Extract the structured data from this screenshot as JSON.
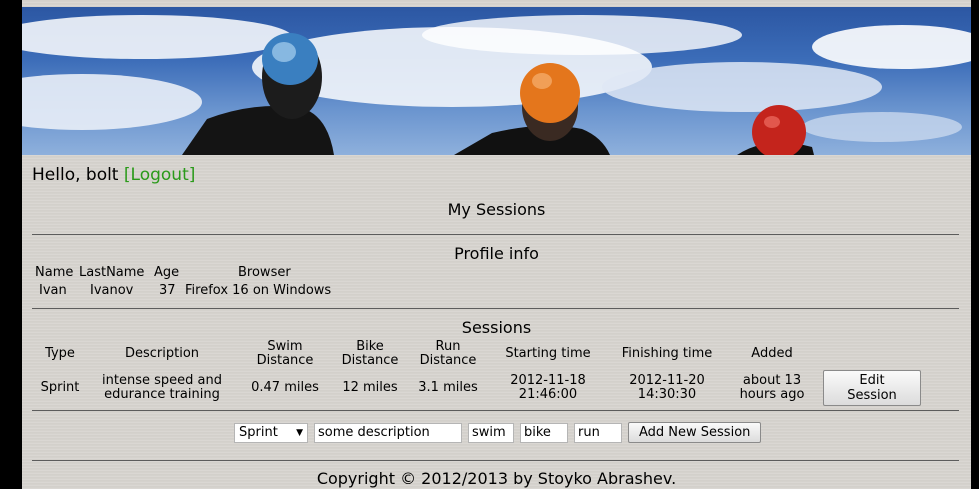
{
  "greeting": {
    "text": "Hello, bolt",
    "logout_label": "[Logout]"
  },
  "page_title": "My Sessions",
  "profile": {
    "title": "Profile info",
    "headers": [
      "Name",
      "LastName",
      "Age",
      "Browser"
    ],
    "values": [
      "Ivan",
      "Ivanov",
      "37",
      "Firefox 16 on Windows"
    ]
  },
  "sessions": {
    "title": "Sessions",
    "headers": {
      "type": "Type",
      "description": "Description",
      "swim_1": "Swim",
      "swim_2": "Distance",
      "bike_1": "Bike",
      "bike_2": "Distance",
      "run_1": "Run",
      "run_2": "Distance",
      "start": "Starting time",
      "finish": "Finishing time",
      "added": "Added"
    },
    "rows": [
      {
        "type": "Sprint",
        "desc_1": "intense speed and",
        "desc_2": "edurance training",
        "swim": "0.47 miles",
        "bike": "12 miles",
        "run": "3.1 miles",
        "start_1": "2012-11-18",
        "start_2": "21:46:00",
        "finish_1": "2012-11-20",
        "finish_2": "14:30:30",
        "added_1": "about 13",
        "added_2": "hours ago",
        "edit_label": "Edit Session"
      }
    ]
  },
  "new_session": {
    "type_value": "Sprint",
    "description_value": "some description",
    "swim_value": "swim",
    "bike_value": "bike",
    "run_value": "run",
    "add_label": "Add New Session"
  },
  "footer": "Copyright © 2012/2013 by Stoyko Abrashev.",
  "colors": {
    "logout": "#2a9a1a",
    "background": "#d6d3ce",
    "sky": "#3b6cb8"
  }
}
